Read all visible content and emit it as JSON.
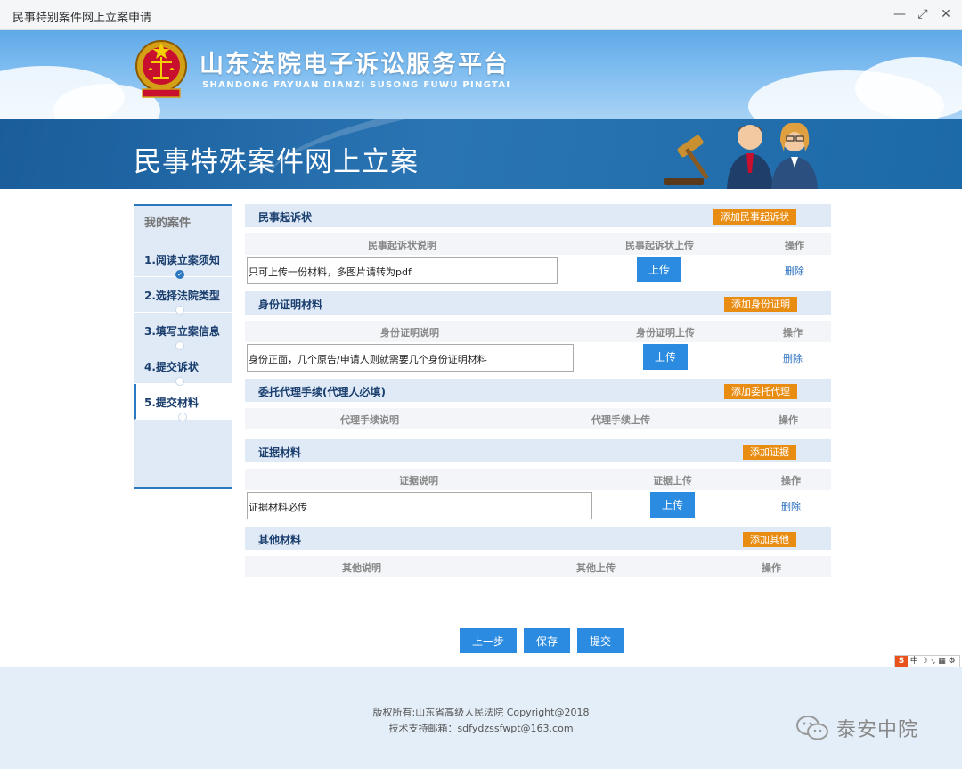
{
  "window": {
    "title": "民事特别案件网上立案申请",
    "controls": [
      "minimize-icon",
      "restore-icon",
      "close-icon"
    ]
  },
  "header": {
    "site_title": "山东法院电子诉讼服务平台",
    "site_subtitle": "SHANDONG FAYUAN DIANZI SUSONG FUWU PINGTAI",
    "hero_title": "民事特殊案件网上立案"
  },
  "sidebar": {
    "heading": "我的案件",
    "steps": [
      {
        "label": "1.阅读立案须知"
      },
      {
        "label": "2.选择法院类型"
      },
      {
        "label": "3.填写立案信息"
      },
      {
        "label": "4.提交诉状"
      },
      {
        "label": "5.提交材料"
      }
    ]
  },
  "sections": {
    "complaint": {
      "title": "民事起诉状",
      "add_button": "添加民事起诉状",
      "col_desc": "民事起诉状说明",
      "col_upload": "民事起诉状上传",
      "col_action": "操作",
      "row_desc": "只可上传一份材料，多图片请转为pdf",
      "upload": "上传",
      "delete": "删除"
    },
    "identity": {
      "title": "身份证明材料",
      "add_button": "添加身份证明",
      "col_desc": "身份证明说明",
      "col_upload": "身份证明上传",
      "col_action": "操作",
      "row_desc": "身份正面，几个原告/申请人则就需要几个身份证明材料",
      "upload": "上传",
      "delete": "删除"
    },
    "agent": {
      "title": "委托代理手续(代理人必填)",
      "add_button": "添加委托代理",
      "col_desc": "代理手续说明",
      "col_upload": "代理手续上传",
      "col_action": "操作"
    },
    "evidence": {
      "title": "证据材料",
      "add_button": "添加证据",
      "col_desc": "证据说明",
      "col_upload": "证据上传",
      "col_action": "操作",
      "row_desc": "证据材料必传",
      "upload": "上传",
      "delete": "删除"
    },
    "other": {
      "title": "其他材料",
      "add_button": "添加其他",
      "col_desc": "其他说明",
      "col_upload": "其他上传",
      "col_action": "操作"
    }
  },
  "actions": {
    "prev": "上一步",
    "save": "保存",
    "submit": "提交"
  },
  "ime": {
    "logo": "S",
    "mode": "中"
  },
  "footer": {
    "copyright": "版权所有:山东省高级人民法院 Copyright@2018",
    "email": "技术支持邮箱：sdfydzssfwpt@163.com",
    "watermark": "泰安中院"
  },
  "colors": {
    "primary_blue": "#2a8be0",
    "accent_orange": "#e98c12",
    "nav_blue": "#1a5d9a"
  }
}
